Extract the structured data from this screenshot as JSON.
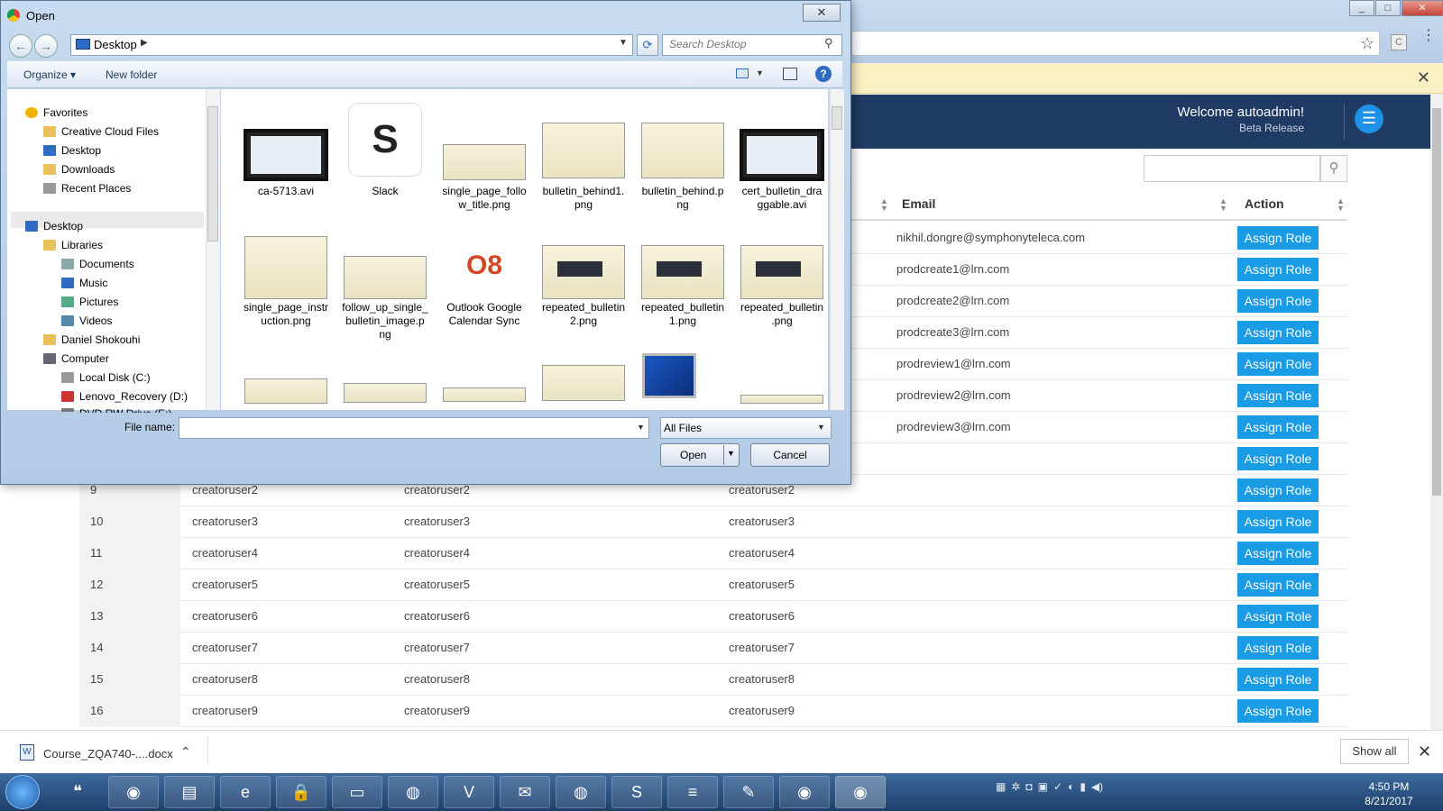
{
  "chrome": {
    "window_controls": [
      "_",
      "□",
      "✕"
    ],
    "ext_letter": "C",
    "infobar_close": "✕"
  },
  "app": {
    "welcome": "Welcome autoadmin!",
    "release": "Beta Release",
    "search_placeholder": "",
    "columns": {
      "email": "Email",
      "action": "Action"
    },
    "upper_rows": [
      {
        "email": "nikhil.dongre@symphonyteleca.com",
        "action": "Assign Role"
      },
      {
        "email": "prodcreate1@lrn.com",
        "action": "Assign Role"
      },
      {
        "email": "prodcreate2@lrn.com",
        "action": "Assign Role"
      },
      {
        "email": "prodcreate3@lrn.com",
        "action": "Assign Role"
      },
      {
        "email": "prodreview1@lrn.com",
        "action": "Assign Role"
      },
      {
        "email": "prodreview2@lrn.com",
        "action": "Assign Role"
      },
      {
        "email": "prodreview3@lrn.com",
        "action": "Assign Role"
      },
      {
        "email": "",
        "action": "Assign Role"
      }
    ],
    "lower_rows": [
      {
        "id": "9",
        "c1": "creatoruser2",
        "c2": "creatoruser2",
        "c3": "creatoruser2",
        "action": "Assign Role"
      },
      {
        "id": "10",
        "c1": "creatoruser3",
        "c2": "creatoruser3",
        "c3": "creatoruser3",
        "action": "Assign Role"
      },
      {
        "id": "11",
        "c1": "creatoruser4",
        "c2": "creatoruser4",
        "c3": "creatoruser4",
        "action": "Assign Role"
      },
      {
        "id": "12",
        "c1": "creatoruser5",
        "c2": "creatoruser5",
        "c3": "creatoruser5",
        "action": "Assign Role"
      },
      {
        "id": "13",
        "c1": "creatoruser6",
        "c2": "creatoruser6",
        "c3": "creatoruser6",
        "action": "Assign Role"
      },
      {
        "id": "14",
        "c1": "creatoruser7",
        "c2": "creatoruser7",
        "c3": "creatoruser7",
        "action": "Assign Role"
      },
      {
        "id": "15",
        "c1": "creatoruser8",
        "c2": "creatoruser8",
        "c3": "creatoruser8",
        "action": "Assign Role"
      },
      {
        "id": "16",
        "c1": "creatoruser9",
        "c2": "creatoruser9",
        "c3": "creatoruser9",
        "action": "Assign Role"
      }
    ]
  },
  "download_bar": {
    "file": "Course_ZQA740-....docx",
    "show_all": "Show all"
  },
  "dialog": {
    "title": "Open",
    "address": "Desktop",
    "search_placeholder": "Search Desktop",
    "organize": "Organize ▾",
    "new_folder": "New folder",
    "nav": {
      "favorites": "Favorites",
      "creative_cloud": "Creative Cloud Files",
      "desktop_fav": "Desktop",
      "downloads": "Downloads",
      "recent": "Recent Places",
      "desktop": "Desktop",
      "libraries": "Libraries",
      "documents": "Documents",
      "music": "Music",
      "pictures": "Pictures",
      "videos": "Videos",
      "user": "Daniel Shokouhi",
      "computer": "Computer",
      "local_disk": "Local Disk (C:)",
      "recovery": "Lenovo_Recovery (D:)",
      "dvd": "DVD RW Drive (E:)"
    },
    "files": [
      {
        "line1": "ca-5713.avi",
        "line2": ""
      },
      {
        "line1": "Slack",
        "line2": ""
      },
      {
        "line1": "single_page_follo",
        "line2": "w_title.png"
      },
      {
        "line1": "bulletin_behind1.",
        "line2": "png"
      },
      {
        "line1": "bulletin_behind.p",
        "line2": "ng"
      },
      {
        "line1": "cert_bulletin_dra",
        "line2": "ggable.avi"
      },
      {
        "line1": "single_page_instr",
        "line2": "uction.png"
      },
      {
        "line1": "follow_up_single_",
        "line2": "bulletin_image.p",
        "line3": "ng"
      },
      {
        "line1": "Outlook Google",
        "line2": "Calendar Sync"
      },
      {
        "line1": "repeated_bulletin",
        "line2": "2.png"
      },
      {
        "line1": "repeated_bulletin",
        "line2": "1.png"
      },
      {
        "line1": "repeated_bulletin",
        "line2": ".png"
      }
    ],
    "filename_label": "File name:",
    "filename_value": "",
    "filetype": "All Files",
    "open": "Open",
    "cancel": "Cancel"
  },
  "taskbar": {
    "time": "4:50 PM",
    "date": "8/21/2017"
  }
}
